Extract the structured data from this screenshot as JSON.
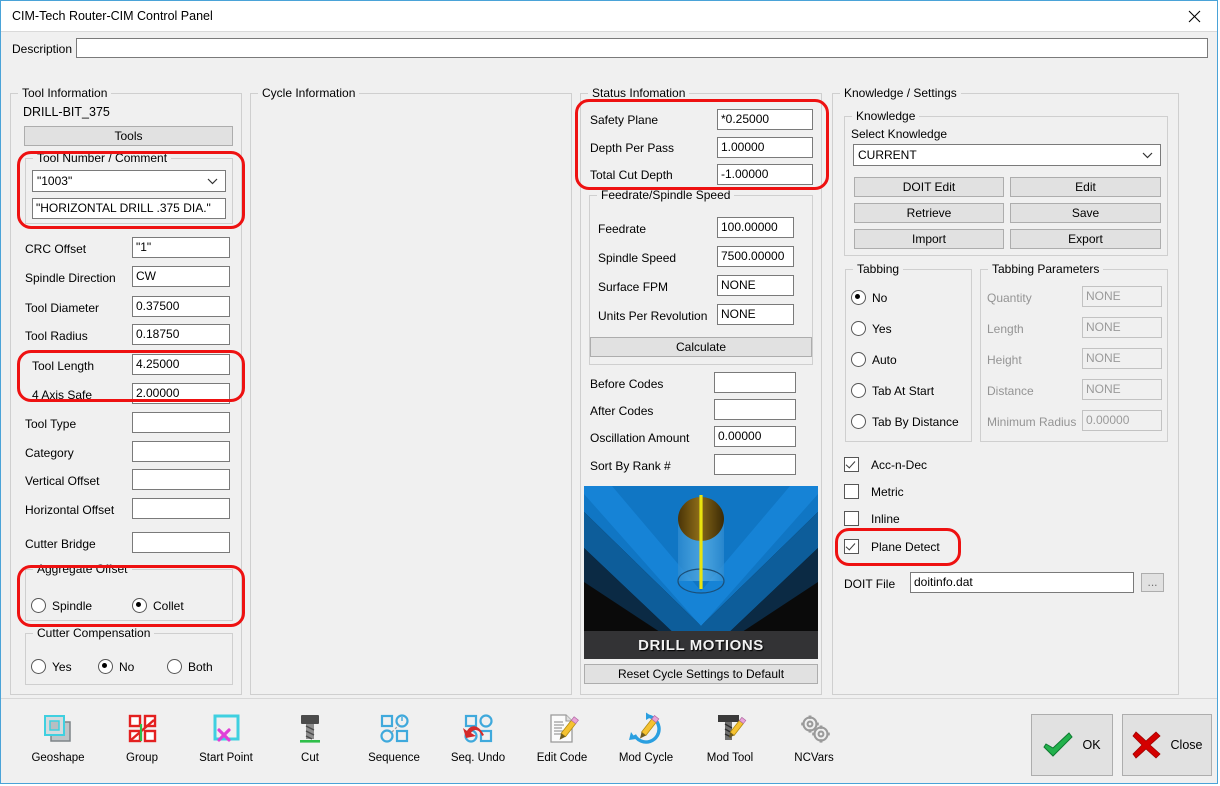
{
  "window": {
    "title": "CIM-Tech Router-CIM Control Panel",
    "close_icon": "close-icon"
  },
  "description": {
    "label": "Description",
    "value": "",
    "placeholder": ""
  },
  "tool_information": {
    "legend": "Tool Information",
    "tool_name": "DRILL-BIT_375",
    "tools_button": "Tools",
    "tool_number_comment": {
      "legend": "Tool Number / Comment",
      "tool_number": "\"1003\"",
      "comment": "\"HORIZONTAL DRILL .375 DIA.\""
    },
    "fields": [
      {
        "label": "CRC Offset",
        "value": "\"1\""
      },
      {
        "label": "Spindle Direction",
        "value": "CW"
      },
      {
        "label": "Tool Diameter",
        "value": "0.37500"
      },
      {
        "label": "Tool Radius",
        "value": "0.18750"
      },
      {
        "label": "Tool Length",
        "value": "4.25000"
      },
      {
        "label": "4 Axis Safe",
        "value": "2.00000"
      },
      {
        "label": "Tool Type",
        "value": ""
      },
      {
        "label": "Category",
        "value": ""
      },
      {
        "label": "Vertical Offset",
        "value": ""
      },
      {
        "label": "Horizontal Offset",
        "value": ""
      },
      {
        "label": "Cutter Bridge",
        "value": ""
      }
    ],
    "aggregate_offset": {
      "legend": "Aggregate Offset",
      "options": [
        {
          "label": "Spindle",
          "checked": false
        },
        {
          "label": "Collet",
          "checked": true
        }
      ]
    },
    "cutter_compensation": {
      "legend": "Cutter Compensation",
      "options": [
        {
          "label": "Yes",
          "checked": false
        },
        {
          "label": "No",
          "checked": true
        },
        {
          "label": "Both",
          "checked": false
        }
      ]
    }
  },
  "cycle_information": {
    "legend": "Cycle Information"
  },
  "status_information": {
    "legend": "Status Infomation",
    "fields": [
      {
        "label": "Safety Plane",
        "value": "*0.25000"
      },
      {
        "label": "Depth Per Pass",
        "value": "1.00000"
      },
      {
        "label": "Total Cut Depth",
        "value": "-1.00000"
      }
    ],
    "feedrate_spindle": {
      "legend": "Feedrate/Spindle Speed",
      "fields": [
        {
          "label": "Feedrate",
          "value": "100.00000"
        },
        {
          "label": "Spindle Speed",
          "value": "7500.00000"
        },
        {
          "label": "Surface FPM",
          "value": "NONE"
        },
        {
          "label": "Units Per Revolution",
          "value": "NONE"
        }
      ],
      "calculate_button": "Calculate"
    },
    "codes": [
      {
        "label": "Before Codes",
        "value": ""
      },
      {
        "label": "After Codes",
        "value": ""
      },
      {
        "label": "Oscillation Amount",
        "value": "0.00000"
      },
      {
        "label": "Sort By Rank #",
        "value": ""
      }
    ],
    "preview_caption": "DRILL MOTIONS",
    "reset_button": "Reset Cycle Settings to Default"
  },
  "knowledge_settings": {
    "legend": "Knowledge / Settings",
    "knowledge": {
      "legend": "Knowledge",
      "select_label": "Select Knowledge",
      "selected": "CURRENT",
      "buttons": [
        "DOIT Edit",
        "Edit",
        "Retrieve",
        "Save",
        "Import",
        "Export"
      ]
    },
    "tabbing": {
      "legend": "Tabbing",
      "options": [
        {
          "label": "No",
          "checked": true
        },
        {
          "label": "Yes",
          "checked": false
        },
        {
          "label": "Auto",
          "checked": false
        },
        {
          "label": "Tab At Start",
          "checked": false
        },
        {
          "label": "Tab By Distance",
          "checked": false
        }
      ]
    },
    "tabbing_parameters": {
      "legend": "Tabbing Parameters",
      "fields": [
        {
          "label": "Quantity",
          "value": "NONE"
        },
        {
          "label": "Length",
          "value": "NONE"
        },
        {
          "label": "Height",
          "value": "NONE"
        },
        {
          "label": "Distance",
          "value": "NONE"
        },
        {
          "label": "Minimum Radius",
          "value": "0.00000"
        }
      ]
    },
    "checkboxes": [
      {
        "label": "Acc-n-Dec",
        "checked": true
      },
      {
        "label": "Metric",
        "checked": false
      },
      {
        "label": "Inline",
        "checked": false
      },
      {
        "label": "Plane Detect",
        "checked": true
      }
    ],
    "doit_file": {
      "label": "DOIT File",
      "value": "doitinfo.dat",
      "browse_button": "..."
    }
  },
  "toolbar": {
    "items": [
      {
        "label": "Geoshape",
        "icon": "geoshape-icon"
      },
      {
        "label": "Group",
        "icon": "group-icon"
      },
      {
        "label": "Start Point",
        "icon": "start-point-icon"
      },
      {
        "label": "Cut",
        "icon": "cut-icon"
      },
      {
        "label": "Sequence",
        "icon": "sequence-icon"
      },
      {
        "label": "Seq. Undo",
        "icon": "seq-undo-icon"
      },
      {
        "label": "Edit Code",
        "icon": "edit-code-icon"
      },
      {
        "label": "Mod Cycle",
        "icon": "mod-cycle-icon"
      },
      {
        "label": "Mod Tool",
        "icon": "mod-tool-icon"
      },
      {
        "label": "NCVars",
        "icon": "ncvars-icon"
      }
    ],
    "ok_button": "OK",
    "close_button": "Close"
  },
  "colors": {
    "annotation": "#ee1111",
    "accent_border": "#4aa3d8",
    "ok_check": "#22b14c",
    "close_x": "#d40000"
  }
}
